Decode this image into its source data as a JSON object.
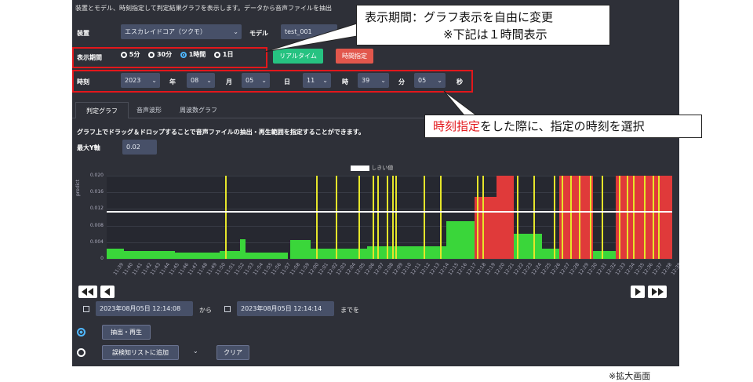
{
  "header_text": "装置とモデル、時刻指定して判定結果グラフを表示します。データから音声ファイルを抽出",
  "device": {
    "label": "装置",
    "value": "エスカレイドコア（ツクモ）"
  },
  "model": {
    "label": "モデル",
    "value": "test_001"
  },
  "period": {
    "label": "表示期間",
    "options": [
      "5分",
      "30分",
      "1時間",
      "1日"
    ],
    "selected": "1時間",
    "realtime": "リアルタイム",
    "time_spec": "時間指定"
  },
  "time": {
    "label": "時刻",
    "year": "2023",
    "year_unit": "年",
    "month": "08",
    "month_unit": "月",
    "day": "05",
    "day_unit": "日",
    "hour": "11",
    "hour_unit": "時",
    "minute": "39",
    "minute_unit": "分",
    "second": "05",
    "second_unit": "秒"
  },
  "tabs": [
    "判定グラフ",
    "音声波形",
    "周波数グラフ"
  ],
  "instruction": "グラフ上でドラッグ＆ドロップすることで音声ファイルの抽出・再生範囲を指定することができます。",
  "max_y": {
    "label": "最大Y軸",
    "value": "0.02"
  },
  "chart_legend": "しきい値",
  "range": {
    "start": "2023年08月05日 12:14:08",
    "from": "から",
    "end": "2023年08月05日 12:14:14",
    "until": "までを"
  },
  "actions": {
    "extract": "抽出・再生",
    "add_list": "誤検知リストに追加",
    "clear": "クリア"
  },
  "callout_period": {
    "line1": "表示期間：グラフ表示を自由に変更",
    "line2": "※下記は１時間表示"
  },
  "callout_time": {
    "red": "時刻指定",
    "rest": "をした際に、指定の時刻を選択"
  },
  "footnote": "※拡大画面",
  "colors": {
    "normal": "#3ad63a",
    "warning": "#e5e52a",
    "alert": "#e03a3a",
    "threshold": "#ffffff",
    "accent": "#26c281"
  },
  "chart_data": {
    "type": "bar",
    "ylabel": "predict",
    "ylim": [
      0,
      0.02
    ],
    "yticks": [
      "0",
      "0.004",
      "0.008",
      "0.012",
      "0.016",
      "0.020"
    ],
    "threshold": 0.0115,
    "x_ticks": [
      "11:39",
      "11:40",
      "11:41",
      "11:42",
      "11:43",
      "11:44",
      "11:45",
      "11:46",
      "11:47",
      "11:48",
      "11:49",
      "11:50",
      "11:51",
      "11:52",
      "11:53",
      "11:54",
      "11:55",
      "11:56",
      "11:57",
      "11:58",
      "11:59",
      "12:00",
      "12:01",
      "12:02",
      "12:03",
      "12:04",
      "12:05",
      "12:06",
      "12:07",
      "12:08",
      "12:09",
      "12:10",
      "12:11",
      "12:12",
      "12:13",
      "12:14",
      "12:15",
      "12:16",
      "12:17",
      "12:18",
      "12:19",
      "12:20",
      "12:21",
      "12:22",
      "12:23",
      "12:24",
      "12:25",
      "12:26",
      "12:27",
      "12:28",
      "12:29",
      "12:30",
      "12:31",
      "12:32",
      "12:33",
      "12:34",
      "12:35",
      "12:36",
      "12:37",
      "12:38",
      "12:39"
    ],
    "segments": [
      {
        "x0": 0.0,
        "x1": 0.03,
        "value": 0.0025,
        "level": "normal"
      },
      {
        "x0": 0.03,
        "x1": 0.12,
        "value": 0.0018,
        "level": "normal"
      },
      {
        "x0": 0.12,
        "x1": 0.2,
        "value": 0.0016,
        "level": "normal"
      },
      {
        "x0": 0.2,
        "x1": 0.236,
        "value": 0.0018,
        "level": "normal"
      },
      {
        "x0": 0.236,
        "x1": 0.246,
        "value": 0.0048,
        "level": "normal"
      },
      {
        "x0": 0.246,
        "x1": 0.32,
        "value": 0.0016,
        "level": "normal"
      },
      {
        "x0": 0.325,
        "x1": 0.36,
        "value": 0.0045,
        "level": "normal"
      },
      {
        "x0": 0.36,
        "x1": 0.46,
        "value": 0.0025,
        "level": "normal"
      },
      {
        "x0": 0.46,
        "x1": 0.6,
        "value": 0.003,
        "level": "normal"
      },
      {
        "x0": 0.6,
        "x1": 0.65,
        "value": 0.009,
        "level": "normal"
      },
      {
        "x0": 0.65,
        "x1": 0.69,
        "value": 0.015,
        "level": "alert"
      },
      {
        "x0": 0.69,
        "x1": 0.72,
        "value": 0.02,
        "level": "alert"
      },
      {
        "x0": 0.72,
        "x1": 0.77,
        "value": 0.006,
        "level": "normal"
      },
      {
        "x0": 0.77,
        "x1": 0.8,
        "value": 0.0025,
        "level": "normal"
      },
      {
        "x0": 0.8,
        "x1": 0.86,
        "value": 0.02,
        "level": "alert"
      },
      {
        "x0": 0.86,
        "x1": 0.9,
        "value": 0.0018,
        "level": "normal"
      },
      {
        "x0": 0.9,
        "x1": 1.0,
        "value": 0.02,
        "level": "alert"
      }
    ],
    "spikes": [
      0.21,
      0.37,
      0.405,
      0.445,
      0.47,
      0.478,
      0.495,
      0.505,
      0.51,
      0.56,
      0.59,
      0.655,
      0.665,
      0.725,
      0.755,
      0.79,
      0.805,
      0.82,
      0.835,
      0.855,
      0.875,
      0.905,
      0.92,
      0.93,
      0.95,
      0.965,
      0.975
    ]
  }
}
